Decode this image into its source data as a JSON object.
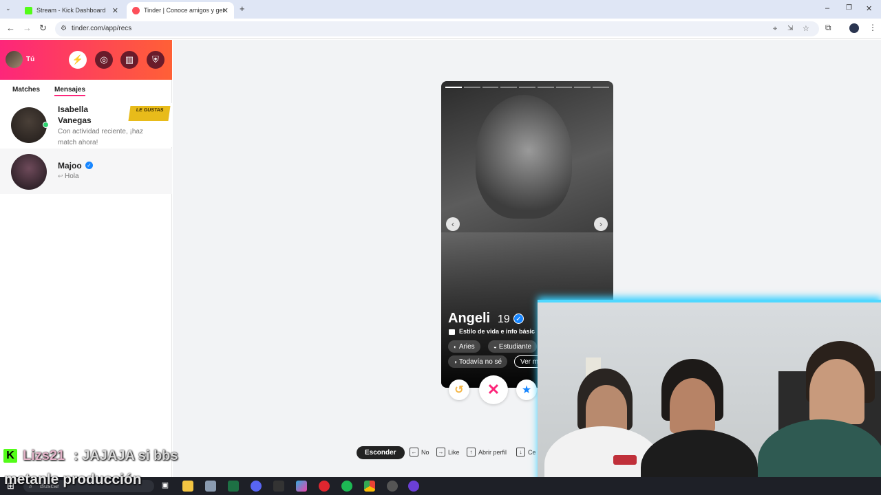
{
  "browser": {
    "tabs": [
      {
        "label": "Stream - Kick Dashboard",
        "close": "✕"
      },
      {
        "label": "Tinder | Conoce amigos y gent",
        "close": "✕"
      }
    ],
    "new_tab": "+",
    "url": "tinder.com/app/recs"
  },
  "sidebar": {
    "user_label": "Tú",
    "tabs": [
      "Matches",
      "Mensajes"
    ],
    "conversations": [
      {
        "name_line1": "Isabella",
        "name_line2": "Vanegas",
        "preview": "Con actividad reciente, ¡haz match ahora!",
        "badge": "LE GUSTAS"
      },
      {
        "name": "Majoo",
        "preview": "Hola",
        "reply_arrow": "↩"
      }
    ]
  },
  "card": {
    "name": "Angeli",
    "age": "19",
    "section_label": "Estilo de vida e info básic",
    "chips": [
      "Aries",
      "Estudiante",
      "Todavía no sé",
      "Ver m"
    ]
  },
  "shortcuts": {
    "hide_button": "Esconder",
    "items": [
      {
        "key": "←",
        "label": "No"
      },
      {
        "key": "→",
        "label": "Like"
      },
      {
        "key": "↑",
        "label": "Abrir perfil"
      },
      {
        "key": "↓",
        "label": "Ce"
      }
    ]
  },
  "stream_overlay": {
    "chat_user": "Lizs21",
    "chat_message": ": JAJAJA si bbs",
    "caption": "metanle producción"
  },
  "taskbar": {
    "search": "Buscar"
  },
  "colors": {
    "tinder_gradient_start": "#fd267a",
    "tinder_gradient_end": "#ff6036",
    "kick_green": "#53fc18",
    "verified_blue": "#1786ff"
  }
}
